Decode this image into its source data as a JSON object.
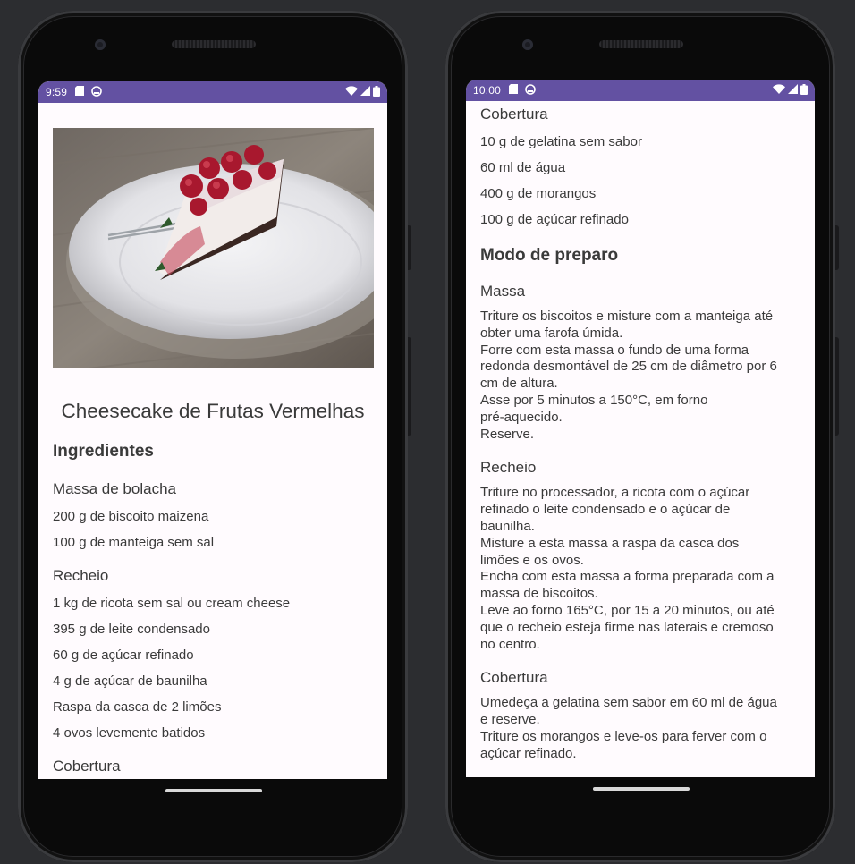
{
  "left_phone": {
    "status": {
      "time": "9:59"
    },
    "image": {
      "alt_subject": "cheesecake-slice-photo"
    },
    "recipe_title": "Cheesecake de Frutas Vermelhas",
    "ingredients_heading": "Ingredientes",
    "massa": {
      "heading": "Massa de bolacha",
      "items": [
        "200 g de biscoito maizena",
        "100 g de manteiga sem sal"
      ]
    },
    "recheio": {
      "heading": "Recheio",
      "items": [
        "1 kg de ricota sem sal ou cream cheese",
        "395 g de leite condensado",
        "60 g de açúcar refinado",
        "4 g de açúcar de baunilha",
        "Raspa da casca de 2 limões",
        "4 ovos levemente batidos"
      ]
    },
    "cobertura_heading": "Cobertura"
  },
  "right_phone": {
    "status": {
      "time": "10:00"
    },
    "cobertura": {
      "heading": "Cobertura",
      "items": [
        "10 g de gelatina sem sabor",
        "60 ml de água",
        "400 g de morangos",
        "100 g de açúcar refinado"
      ]
    },
    "preparo_heading": "Modo de preparo",
    "steps": [
      {
        "heading": "Massa",
        "text": "Triture os biscoitos e misture com a manteiga até\nobter uma farofa úmida.\nForre com esta massa o fundo de uma forma\nredonda desmontável de 25 cm de diâmetro por 6\ncm de altura.\nAsse por 5 minutos a 150°C, em forno\npré-aquecido.\nReserve."
      },
      {
        "heading": "Recheio",
        "text": "Triture no processador, a ricota com o açúcar\nrefinado o leite condensado e o açúcar de\nbaunilha.\nMisture a esta massa a raspa da casca dos\nlimões e os ovos.\nEncha com esta massa a forma preparada com a\nmassa de biscoitos.\nLeve ao forno 165°C, por 15 a 20 minutos, ou até\nque o recheio esteja firme nas laterais e cremoso\nno centro."
      },
      {
        "heading": "Cobertura",
        "text": "Umedeça a gelatina sem sabor em 60 ml de água\ne reserve.\nTriture os morangos e leve-os para ferver com o\naçúcar refinado."
      }
    ]
  },
  "colors": {
    "status_bar": "#6351a2",
    "screen_bg": "#fffbfe",
    "text": "#3a3a3a"
  },
  "icons": [
    "sd-card-icon",
    "android-debug-icon",
    "wifi-icon",
    "cellular-signal-icon",
    "battery-icon"
  ]
}
